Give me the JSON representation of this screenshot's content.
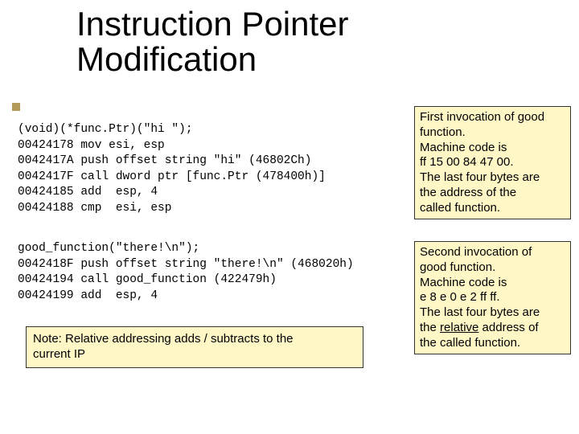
{
  "title_line1": "Instruction Pointer",
  "title_line2": "Modification",
  "code1": "(void)(*func.Ptr)(\"hi \");\n00424178 mov esi, esp\n0042417A push offset string \"hi\" (46802Ch)\n0042417F call dword ptr [func.Ptr (478400h)]\n00424185 add  esp, 4\n00424188 cmp  esi, esp",
  "code2": "good_function(\"there!\\n\");\n0042418F push offset string \"there!\\n\" (468020h)\n00424194 call good_function (422479h)\n00424199 add  esp, 4",
  "annot1": {
    "l1": "First invocation of good",
    "l2": "function.",
    "l3": "Machine code is",
    "l4": "ff 15 00 84 47 00.",
    "l5": "The last four bytes are",
    "l6": "the address of the",
    "l7": "called function."
  },
  "annot2": {
    "l1": "Second invocation of",
    "l2": "good function.",
    "l3": "Machine code is",
    "l4": "e 8 e 0 e 2 ff ff.",
    "l5a": "The last four bytes are",
    "l5b": "the ",
    "l5c": "relative",
    "l5d": " address of",
    "l6": "the called function."
  },
  "annot3": {
    "l1": "Note: Relative addressing adds / subtracts to the",
    "l2": "current IP"
  }
}
